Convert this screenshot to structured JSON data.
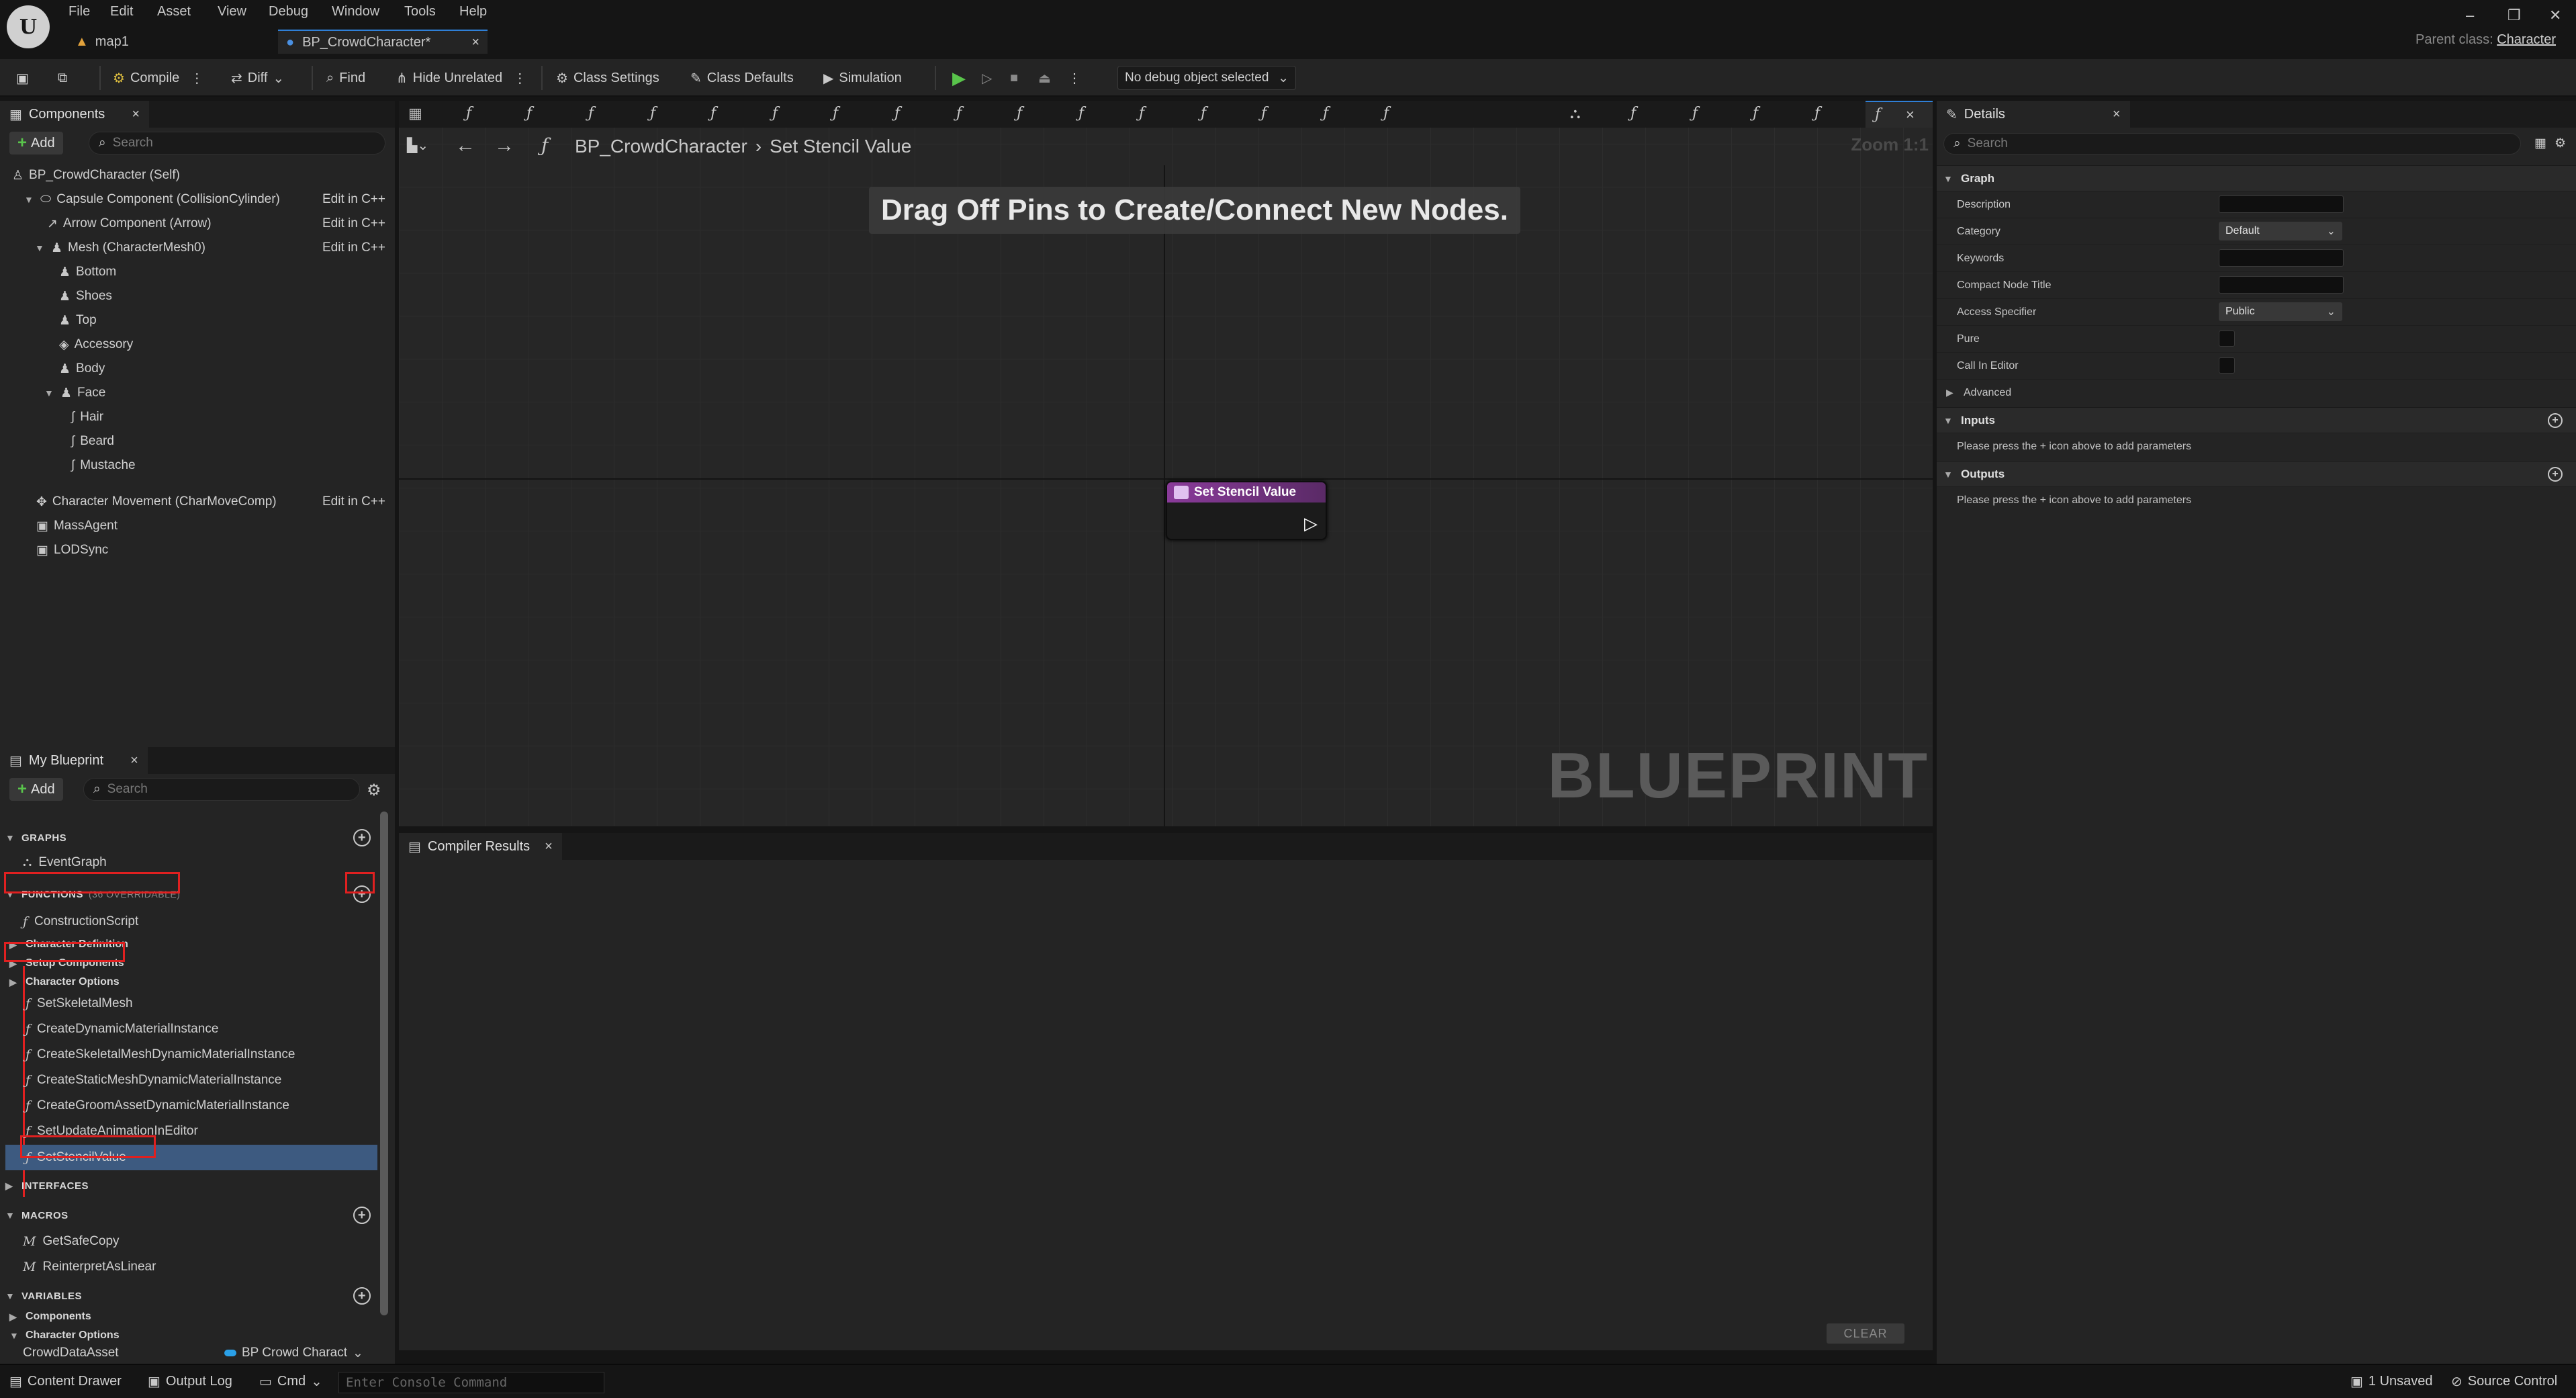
{
  "menubar": {
    "items": [
      "File",
      "Edit",
      "Asset",
      "View",
      "Debug",
      "Window",
      "Tools",
      "Help"
    ],
    "tabs": [
      {
        "label": "map1"
      },
      {
        "label": "BP_CrowdCharacter*"
      }
    ],
    "parent_class_label": "Parent class:",
    "parent_class_value": "Character"
  },
  "toolbar": {
    "compile": "Compile",
    "diff": "Diff",
    "find": "Find",
    "hide_unrelated": "Hide Unrelated",
    "class_settings": "Class Settings",
    "class_defaults": "Class Defaults",
    "simulation": "Simulation",
    "debug_object": "No debug object selected"
  },
  "components": {
    "title": "Components",
    "add": "Add",
    "search_placeholder": "Search",
    "edit_cpp": "Edit in C++",
    "items": [
      {
        "label": "BP_CrowdCharacter (Self)"
      },
      {
        "label": "Capsule Component (CollisionCylinder)"
      },
      {
        "label": "Arrow Component (Arrow)"
      },
      {
        "label": "Mesh (CharacterMesh0)"
      },
      {
        "label": "Bottom"
      },
      {
        "label": "Shoes"
      },
      {
        "label": "Top"
      },
      {
        "label": "Accessory"
      },
      {
        "label": "Body"
      },
      {
        "label": "Face"
      },
      {
        "label": "Hair"
      },
      {
        "label": "Beard"
      },
      {
        "label": "Mustache"
      },
      {
        "label": "Character Movement (CharMoveComp)"
      },
      {
        "label": "MassAgent"
      },
      {
        "label": "LODSync"
      }
    ]
  },
  "my_blueprint": {
    "title": "My Blueprint",
    "add": "Add",
    "search_placeholder": "Search",
    "graphs_label": "GRAPHS",
    "event_graph": "EventGraph",
    "functions_label": "FUNCTIONS",
    "functions_count": "(36 OVERRIDABLE)",
    "construction_script": "ConstructionScript",
    "categories": [
      "Character Definition",
      "Setup Components",
      "Character Options"
    ],
    "functions": [
      "SetSkeletalMesh",
      "CreateDynamicMaterialInstance",
      "CreateSkeletalMeshDynamicMaterialInstance",
      "CreateStaticMeshDynamicMaterialInstance",
      "CreateGroomAssetDynamicMaterialInstance",
      "SetUpdateAnimationInEditor",
      "SetStencilValue"
    ],
    "interfaces_label": "INTERFACES",
    "macros_label": "MACROS",
    "macros": [
      "GetSafeCopy",
      "ReinterpretAsLinear"
    ],
    "variables_label": "VARIABLES",
    "var_categories": [
      "Components",
      "Character Options"
    ],
    "variable_name": "CrowdDataAsset",
    "variable_type": "BP Crowd Charact"
  },
  "graph": {
    "breadcrumb_root": "BP_CrowdCharacter",
    "breadcrumb_current": "Set Stencil Value",
    "zoom": "Zoom 1:1",
    "hint": "Drag Off Pins to Create/Connect New Nodes.",
    "watermark": "BLUEPRINT",
    "node_title": "Set Stencil Value",
    "node_color": "#8a3b9a"
  },
  "compiler": {
    "title": "Compiler Results",
    "clear": "CLEAR"
  },
  "details": {
    "title": "Details",
    "search_placeholder": "Search",
    "graph_section": "Graph",
    "rows": {
      "description": "Description",
      "category": "Category",
      "category_value": "Default",
      "keywords": "Keywords",
      "compact_node_title": "Compact Node Title",
      "access_specifier": "Access Specifier",
      "access_value": "Public",
      "pure": "Pure",
      "call_in_editor": "Call In Editor"
    },
    "advanced": "Advanced",
    "inputs": "Inputs",
    "inputs_hint": "Please press the + icon above to add parameters",
    "outputs": "Outputs",
    "outputs_hint": "Please press the + icon above to add parameters"
  },
  "statusbar": {
    "content_drawer": "Content Drawer",
    "output_log": "Output Log",
    "cmd": "Cmd",
    "console_placeholder": "Enter Console Command",
    "unsaved": "1 Unsaved",
    "source_control": "Source Control"
  },
  "colors": {
    "accent_blue": "#2f7fd6",
    "highlight_red": "#e02020",
    "selection_blue": "#3d5a80",
    "function_node": "#8a3b9a"
  }
}
